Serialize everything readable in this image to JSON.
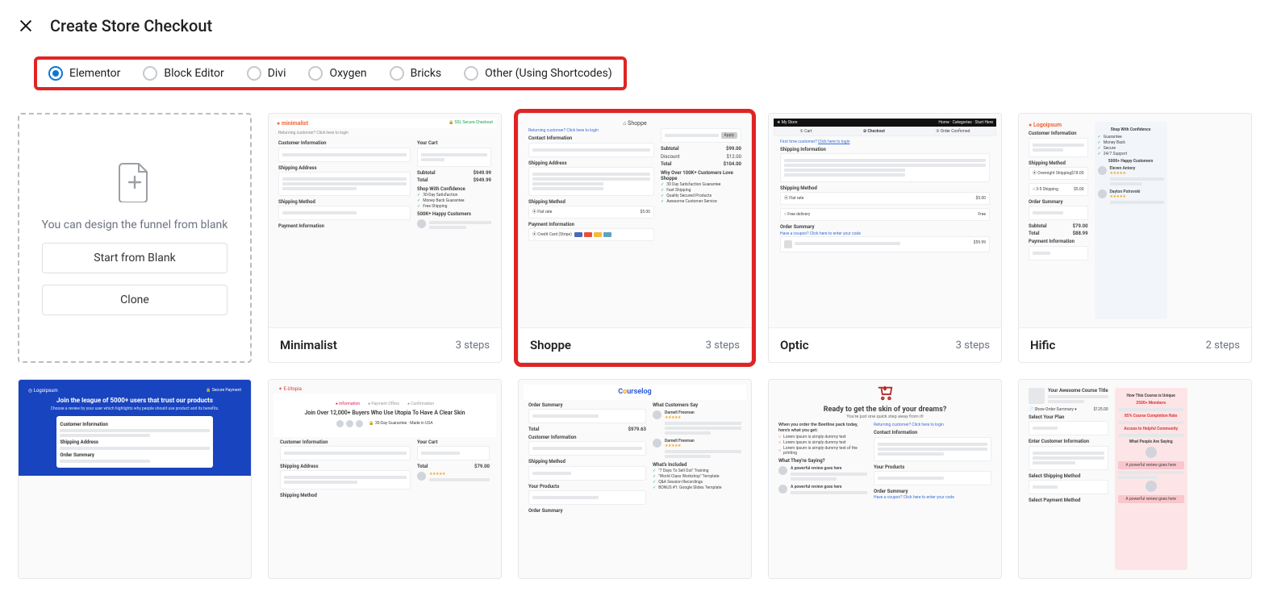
{
  "header": {
    "title": "Create Store Checkout"
  },
  "builders": {
    "options": [
      {
        "id": "elementor",
        "label": "Elementor",
        "checked": true
      },
      {
        "id": "block",
        "label": "Block Editor",
        "checked": false
      },
      {
        "id": "divi",
        "label": "Divi",
        "checked": false
      },
      {
        "id": "oxygen",
        "label": "Oxygen",
        "checked": false
      },
      {
        "id": "bricks",
        "label": "Bricks",
        "checked": false
      },
      {
        "id": "other",
        "label": "Other (Using Shortcodes)",
        "checked": false
      }
    ]
  },
  "blank_card": {
    "caption": "You can design the funnel from blank",
    "start_label": "Start from Blank",
    "clone_label": "Clone"
  },
  "templates": [
    {
      "name": "Minimalist",
      "steps": "3 steps",
      "highlight": false,
      "kind": "minimalist"
    },
    {
      "name": "Shoppe",
      "steps": "3 steps",
      "highlight": true,
      "kind": "shoppe"
    },
    {
      "name": "Optic",
      "steps": "3 steps",
      "highlight": false,
      "kind": "optic"
    },
    {
      "name": "Hific",
      "steps": "2 steps",
      "highlight": false,
      "kind": "hific"
    }
  ],
  "templates_row2": [
    {
      "kind": "blue_login"
    },
    {
      "kind": "utopia"
    },
    {
      "kind": "courselog"
    },
    {
      "kind": "beetline"
    },
    {
      "kind": "course_pink"
    }
  ],
  "preview_strings": {
    "logo_minimalist": "minimalist",
    "ssl": "SSL Secure Checkout",
    "returning": "Returning customer? Click here to login",
    "contact_info": "Contact Information",
    "customer_info": "Customer Information",
    "your_cart": "Your Cart",
    "shipping_address": "Shipping Address",
    "shipping_method": "Shipping Method",
    "shipping_info": "Shipping Information",
    "payment_info": "Payment Information",
    "order_summary": "Order Summary",
    "shop_confidence": "Shop With Confidence",
    "happy_customers": "500K+ Happy Customers",
    "total_label": "Total",
    "subtotal_label": "Subtotal",
    "shipping_label": "Shipping",
    "total_value_shoppe": "$104.00",
    "total_value_min": "$949.99",
    "why_love": "Why Over 100K+ Customers Love Shoppe",
    "logo_shoppe": "Shoppe",
    "logo_optic": "My Store",
    "logo_hific": "Logoipsum",
    "logo_logoipsum": "Logoipsum",
    "logo_eutopia": "E-Utopia",
    "logo_courselog": "Courselog",
    "blue_hero": "Join the league of 5000+ users that trust our products",
    "utopia_hero": "Join Over 12,000+ Buyers Who Use Utopia To Have A Clear Skin",
    "ready_hero": "Ready to get the skin of your dreams?",
    "ready_sub": "You're just one quick step away from it!",
    "beetline_lead": "When you order the Beetline pack today, here's what you get:",
    "what_saying": "What They're Saying?",
    "customers_say": "What Customers Say",
    "whats_included": "What's Included",
    "your_products": "Your Products",
    "course_title": "Your Awesome Course Title",
    "unique": "How This Course is Unique",
    "members": "2500+ Members",
    "completion": "85% Course Completion Rate",
    "community": "Access to Helpful Community",
    "people_saying": "What People Are Saying",
    "enter_customer": "Enter Customer Information",
    "select_plan": "Select Your Plan",
    "select_shipping": "Select Shipping Method",
    "select_payment": "Select Payment Method",
    "powerful_review": "A powerful review goes here"
  }
}
